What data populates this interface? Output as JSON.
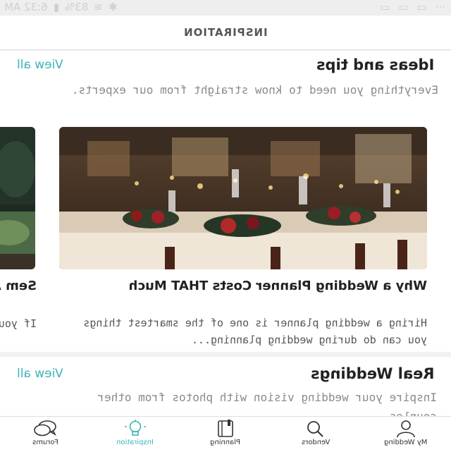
{
  "status_bar": {
    "time": "6:32 AM",
    "battery": "83%"
  },
  "header": {
    "title": "INSPIRATION"
  },
  "sections": [
    {
      "title": "Ideas and tips",
      "view_all": "View all",
      "description": "Everything you need to know straight from our experts."
    },
    {
      "title": "Real Weddings",
      "view_all": "View all",
      "description": "Inspire your wedding vision with photos from other couples."
    }
  ],
  "articles": [
    {
      "title": "Why a Wedding Planner Costs THAT Much",
      "description": "Hiring a wedding planner is one of the smartest things you can do during wedding planning..."
    },
    {
      "title": "Sem Attir",
      "description": "If you you'r"
    }
  ],
  "bottom_nav": [
    {
      "label": "My Wedding",
      "icon": "person-icon"
    },
    {
      "label": "Vendors",
      "icon": "search-icon"
    },
    {
      "label": "Planning",
      "icon": "notebook-icon"
    },
    {
      "label": "Inspiration",
      "icon": "lightbulb-icon",
      "active": true
    },
    {
      "label": "Forums",
      "icon": "chat-bubbles-icon"
    }
  ],
  "colors": {
    "accent": "#3cb3b7",
    "background": "#f2f2f2"
  }
}
